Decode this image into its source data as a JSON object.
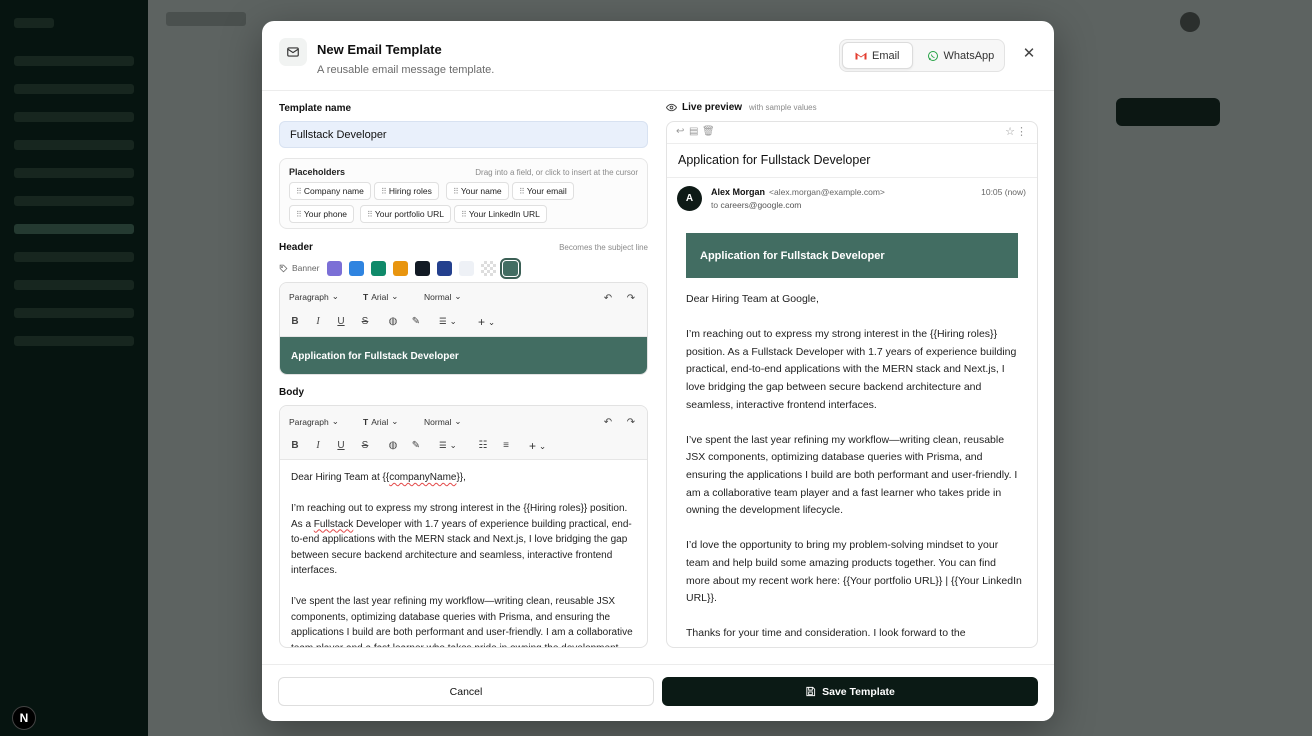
{
  "modal": {
    "title": "New Email Template",
    "subtitle": "A reusable email message template.",
    "channels": [
      "Email",
      "WhatsApp"
    ],
    "active_channel": "Email",
    "close_icon": "close-icon"
  },
  "form": {
    "template_name_label": "Template name",
    "template_name_value": "Fullstack Developer",
    "placeholders_label": "Placeholders",
    "placeholders_hint": "Drag into a field, or click to insert at the cursor",
    "placeholders": [
      "Company name",
      "Hiring roles",
      "Your name",
      "Your email",
      "Your phone",
      "Your portfolio URL",
      "Your LinkedIn URL"
    ],
    "header_label": "Header",
    "header_hint": "Becomes the subject line",
    "banner_label": "Banner",
    "banner_swatches": [
      "#7b6fd6",
      "#2f84e0",
      "#0f8a6a",
      "#e8950f",
      "#121a24",
      "#24408e",
      "#eef1f6",
      "checker",
      "#426d62"
    ],
    "selected_swatch": "#426d62",
    "header_text": "Application for Fullstack Developer",
    "body_label": "Body",
    "toolbar": {
      "block": "Paragraph",
      "font": "Arial",
      "size": "Normal"
    },
    "body_paragraphs": [
      {
        "pre": "Dear Hiring Team at {{",
        "squiggle": "companyName",
        "post": "}},"
      },
      {
        "pre": "I’m reaching out to express my strong interest in the {{Hiring roles}} position. As a ",
        "squiggle": "Fullstack",
        "post": " Developer with 1.7 years of experience building practical, end-to-end applications with the MERN stack and Next.js, I love bridging the gap between secure backend architecture and seamless, interactive frontend interfaces."
      },
      {
        "pre": "I’ve spent the last year refining my workflow—writing clean, reusable JSX components, optimizing database queries with Prisma, and ensuring the applications I build are both performant and user-friendly. I am a collaborative team player and a fast learner who takes pride in owning the development lifecycle.",
        "squiggle": "",
        "post": ""
      }
    ]
  },
  "preview": {
    "label": "Live preview",
    "label_note": "with sample values",
    "subject": "Application for Fullstack Developer",
    "avatar_letter": "A",
    "from_name": "Alex Morgan",
    "from_email": "<alex.morgan@example.com>",
    "to_prefix": "to",
    "to_email": "careers@google.com",
    "time": "10:05 (now)",
    "banner_text": "Application for Fullstack Developer",
    "paragraphs": [
      "Dear Hiring Team at Google,",
      "I’m reaching out to express my strong interest in the {{Hiring roles}} position. As a Fullstack Developer with 1.7 years of experience building practical, end-to-end applications with the MERN stack and Next.js, I love bridging the gap between secure backend architecture and seamless, interactive frontend interfaces.",
      "I’ve spent the last year refining my workflow—writing clean, reusable JSX components, optimizing database queries with Prisma, and ensuring the applications I build are both performant and user-friendly. I am a collaborative team player and a fast learner who takes pride in owning the development lifecycle.",
      "I’d love the opportunity to bring my problem-solving mindset to your team and help build some amazing products together. You can find more about my recent work here: {{Your portfolio URL}} | {{Your LinkedIn URL}}.",
      "Thanks for your time and consideration. I look forward to the"
    ]
  },
  "footer": {
    "cancel_label": "Cancel",
    "save_label": "Save Template"
  },
  "badge": {
    "letter": "N"
  }
}
